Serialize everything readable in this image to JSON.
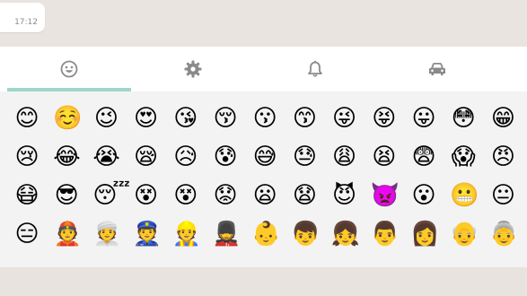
{
  "message": {
    "time": "17:12"
  },
  "tabs": [
    {
      "name": "smileys",
      "icon": "smiley-icon",
      "active": true
    },
    {
      "name": "objects",
      "icon": "gear-icon",
      "active": false
    },
    {
      "name": "notifications",
      "icon": "bell-icon",
      "active": false
    },
    {
      "name": "vehicles",
      "icon": "car-icon",
      "active": false
    }
  ],
  "colors": {
    "accent": "#9fd6cc",
    "panel": "#f3f3f3",
    "chat_background": "#e9e4df"
  },
  "emoji_rows": [
    [
      "😊",
      "☺️",
      "😉",
      "😍",
      "😘",
      "😚",
      "😗",
      "😙",
      "😜",
      "😝",
      "😛",
      "😳",
      "😁"
    ],
    [
      "😢",
      "😂",
      "😭",
      "😪",
      "😥",
      "😰",
      "😅",
      "😓",
      "😩",
      "😫",
      "😨",
      "😱",
      "😠"
    ],
    [
      "😷",
      "😎",
      "😴",
      "😵",
      "😵",
      "😟",
      "😦",
      "😧",
      "😈",
      "👿",
      "😮",
      "😬",
      "😐"
    ],
    [
      "😑",
      "👲",
      "👳",
      "👮",
      "👷",
      "💂",
      "👶",
      "👦",
      "👧",
      "👨",
      "👩",
      "👴",
      "👵"
    ]
  ]
}
